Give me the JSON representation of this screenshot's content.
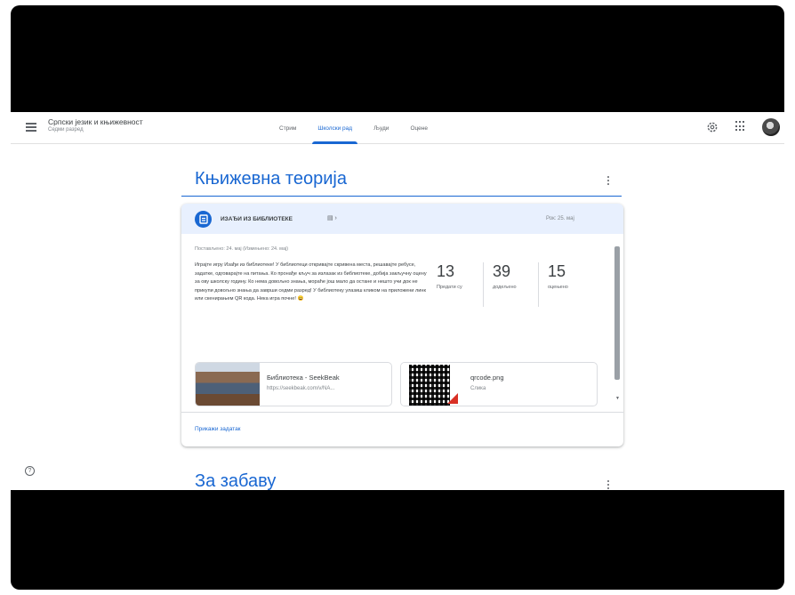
{
  "header": {
    "class_name": "Српски језик и књижевност",
    "class_section": "Седми разред",
    "tabs": [
      {
        "label": "Стрим",
        "active": false
      },
      {
        "label": "Школски рад",
        "active": true
      },
      {
        "label": "Људи",
        "active": false
      },
      {
        "label": "Оцене",
        "active": false
      }
    ],
    "icons": [
      "menu-icon",
      "gear-icon",
      "apps-icon",
      "avatar"
    ]
  },
  "topics": [
    {
      "title": "Књижевна теорија"
    },
    {
      "title": "За забаву"
    }
  ],
  "assignment": {
    "title": "ИЗАЂИ ИЗ БИБЛИОТЕКЕ",
    "attach_marker": "▤ ›",
    "due": "Рок: 25. мај",
    "posted": "Постављено: 24. мај (Измењено: 24. мај)",
    "description": "Играјте игру Изађи из библиотеке! У библиотеци откривајте скривена места, решавајте ребусе, задатке, одговарајте на питања. Ко пронађе кључ за излазак из библиотеке, добија закључну оцену за ову школску годину. Ко нема довољно знања, мораће још мало да остане и нешто учи док не прикупи довољно знања да заврши седми разред! У библиотеку улазиш кликом на приложени линк или скенирањем QR кода. Нека игра почне! 😀",
    "stats": [
      {
        "number": "13",
        "label": "Предати су"
      },
      {
        "number": "39",
        "label": "додељено"
      },
      {
        "number": "15",
        "label": "оцењено"
      }
    ],
    "attachments": [
      {
        "name": "Библиотека - SeekBeak",
        "sub": "https://seekbeak.com/v/NA..."
      },
      {
        "name": "qrcode.png",
        "sub": "Слика"
      }
    ],
    "view_link": "Прикажи задатак"
  },
  "colors": {
    "accent": "#1967d2",
    "header_bg": "#e8f0fe"
  }
}
